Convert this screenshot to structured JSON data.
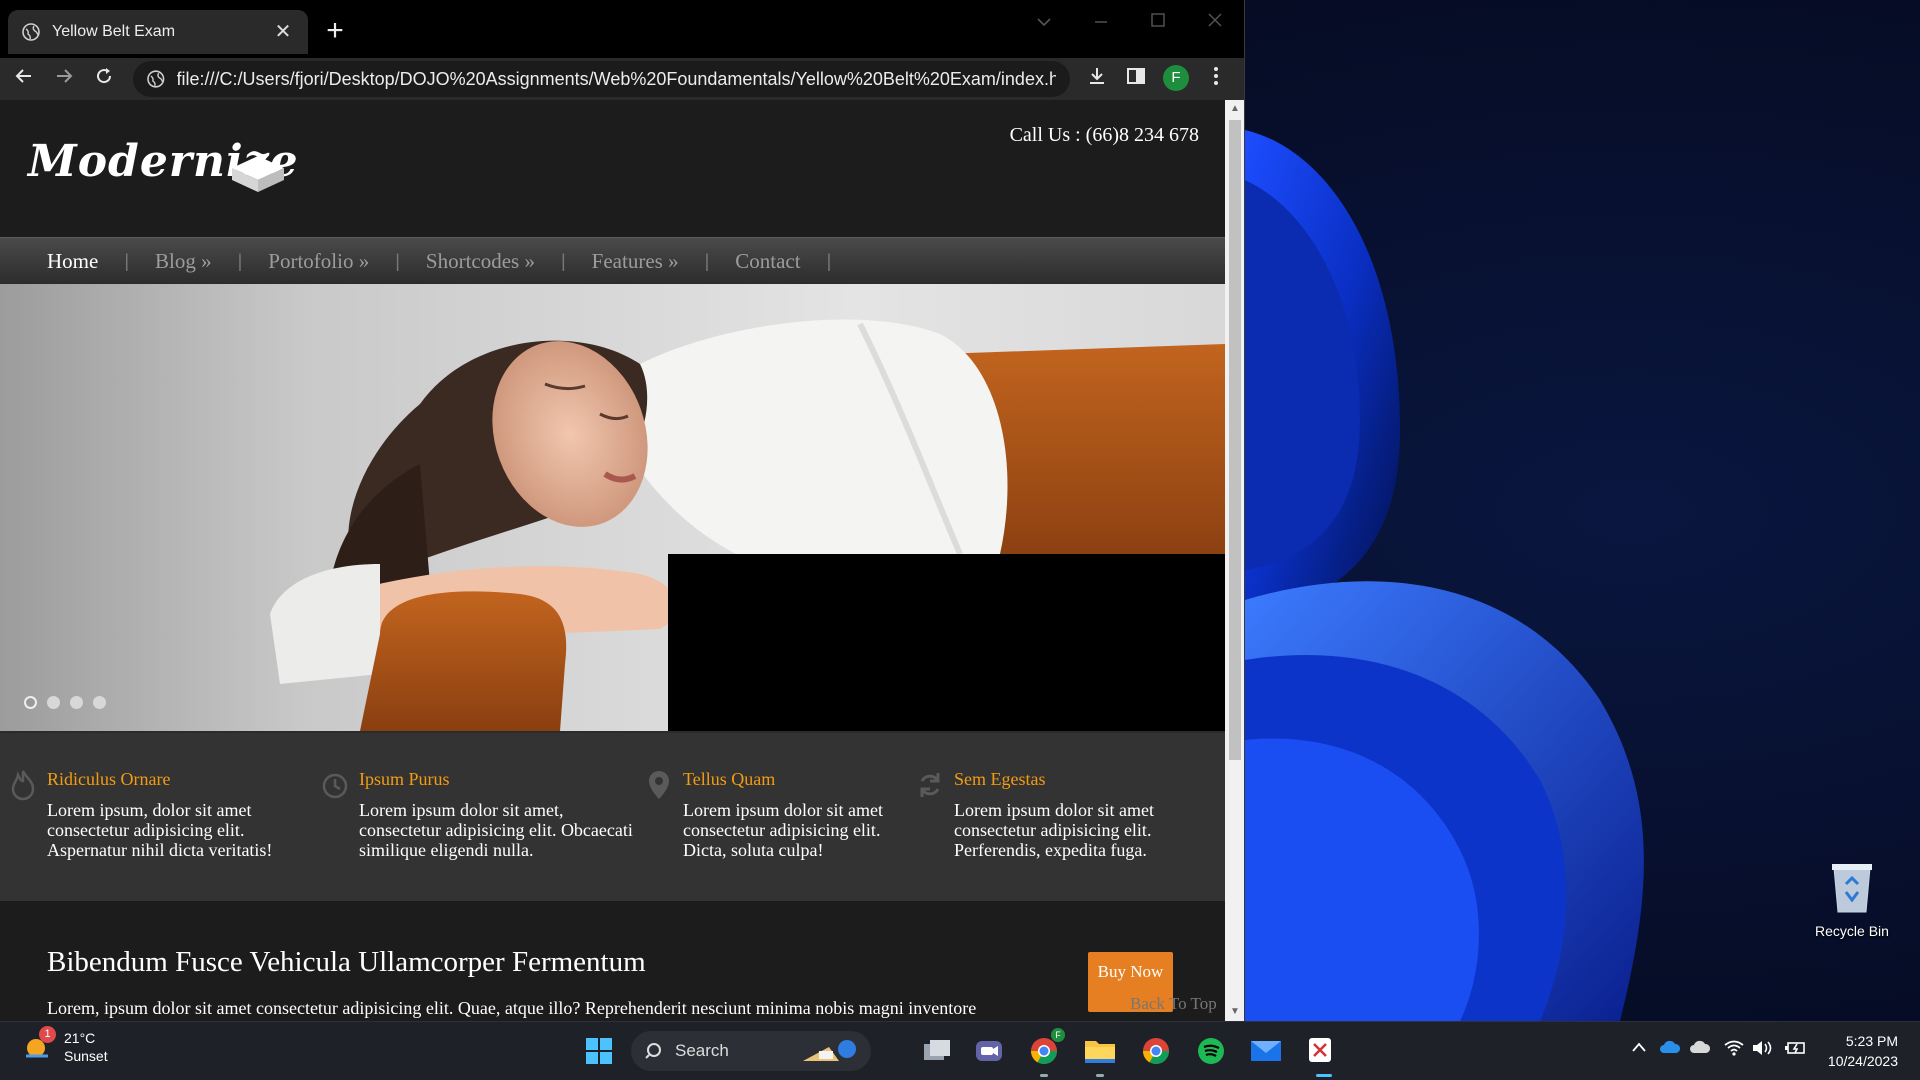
{
  "browser": {
    "tab_title": "Yellow Belt Exam",
    "tab_close": "✕",
    "new_tab": "+",
    "url": "file:///C:/Users/fjori/Desktop/DOJO%20Assignments/Web%20Foundamentals/Yellow%20Belt%20Exam/index.ht...",
    "profile_initial": "F"
  },
  "site": {
    "logo": "Modernize",
    "call_us": "Call Us : (66)8 234 678",
    "nav": [
      {
        "label": "Home"
      },
      {
        "label": "Blog »"
      },
      {
        "label": "Portofolio »"
      },
      {
        "label": "Shortcodes »"
      },
      {
        "label": "Features »"
      },
      {
        "label": "Contact"
      }
    ],
    "slider_dots": 4,
    "features": [
      {
        "title": "Ridiculus Ornare",
        "icon": "fire-icon",
        "text": "Lorem ipsum, dolor sit amet consectetur adipisicing elit. Aspernatur nihil dicta veritatis!"
      },
      {
        "title": "Ipsum Purus",
        "icon": "clock-icon",
        "text": "Lorem ipsum dolor sit amet, consectetur adipisicing elit. Obcaecati similique eligendi nulla."
      },
      {
        "title": "Tellus Quam",
        "icon": "map-pin-icon",
        "text": "Lorem ipsum dolor sit amet consectetur adipisicing elit. Dicta, soluta culpa!"
      },
      {
        "title": "Sem Egestas",
        "icon": "refresh-icon",
        "text": "Lorem ipsum dolor sit amet consectetur adipisicing elit. Perferendis, expedita fuga."
      }
    ],
    "content_title": "Bibendum Fusce Vehicula Ullamcorper Fermentum",
    "content_text": "Lorem, ipsum dolor sit amet consectetur adipisicing elit. Quae, atque illo? Reprehenderit nesciunt minima nobis magni inventore",
    "buy_button": "Buy Now",
    "back_to_top": "Back To Top",
    "accent_color": "#f39c12"
  },
  "desktop": {
    "recycle_bin": "Recycle Bin"
  },
  "taskbar": {
    "weather_temp": "21°C",
    "weather_desc": "Sunset",
    "weather_badge": "1",
    "search_label": "Search",
    "chrome_badge": "F",
    "time": "5:23 PM",
    "date": "10/24/2023"
  }
}
